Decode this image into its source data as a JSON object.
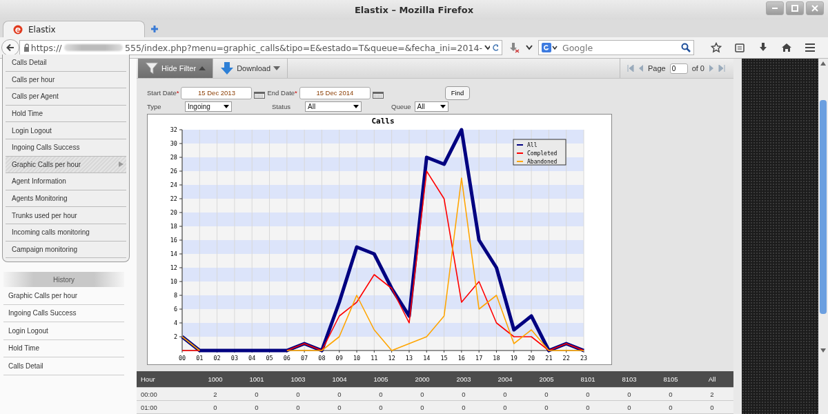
{
  "browser": {
    "title": "Elastix – Mozilla Firefox",
    "tab": "Elastix",
    "url_scheme": "https://",
    "url": "555/index.php?menu=graphic_calls&tipo=E&estado=T&queue=&fecha_ini=2014-",
    "search_placeholder": "Google"
  },
  "sidebar": {
    "items": [
      {
        "label": "Calls Detail",
        "selected": false
      },
      {
        "label": "Calls per hour",
        "selected": false
      },
      {
        "label": "Calls per Agent",
        "selected": false
      },
      {
        "label": "Hold Time",
        "selected": false
      },
      {
        "label": "Login Logout",
        "selected": false
      },
      {
        "label": "Ingoing Calls Success",
        "selected": false
      },
      {
        "label": "Graphic Calls per hour",
        "selected": true
      },
      {
        "label": "Agent Information",
        "selected": false
      },
      {
        "label": "Agents Monitoring",
        "selected": false
      },
      {
        "label": "Trunks used per hour",
        "selected": false
      },
      {
        "label": "Incoming calls monitoring",
        "selected": false
      },
      {
        "label": "Campaign monitoring",
        "selected": false
      }
    ],
    "history_title": "History",
    "history": [
      "Graphic Calls per hour",
      "Ingoing Calls Success",
      "Login Logout",
      "Hold Time",
      "Calls Detail"
    ]
  },
  "toolbar": {
    "hide_filter": "Hide Filter",
    "download": "Download",
    "page_label": "Page",
    "page_value": "0",
    "of_label": "of 0"
  },
  "filter": {
    "start_label": "Start Date",
    "start_value": "15 Dec 2013",
    "end_label": "End Date",
    "end_value": "15 Dec 2014",
    "required_mark": "*",
    "find": "Find",
    "type_label": "Type",
    "type_value": "Ingoing",
    "status_label": "Status",
    "status_value": "All",
    "queue_label": "Queue",
    "queue_value": "All"
  },
  "chart": {
    "chart_data": {
      "type": "line",
      "title": "Calls",
      "categories": [
        "00",
        "01",
        "02",
        "03",
        "04",
        "05",
        "06",
        "07",
        "08",
        "09",
        "10",
        "11",
        "12",
        "13",
        "14",
        "15",
        "16",
        "17",
        "18",
        "19",
        "20",
        "21",
        "22",
        "23"
      ],
      "ylim": [
        0,
        32
      ],
      "grid": true,
      "legend": true,
      "yticks": [
        2,
        4,
        6,
        8,
        10,
        12,
        14,
        16,
        18,
        20,
        22,
        24,
        26,
        28,
        30,
        32
      ],
      "series": [
        {
          "name": "All",
          "color": "#000080",
          "values": [
            2,
            0,
            0,
            0,
            0,
            0,
            0,
            1,
            0,
            7,
            15,
            14,
            9,
            5,
            28,
            27,
            32,
            16,
            12,
            3,
            5,
            0,
            1,
            0
          ]
        },
        {
          "name": "Completed",
          "color": "#ff0000",
          "values": [
            0,
            0,
            null,
            null,
            null,
            null,
            0,
            1,
            0,
            5,
            7,
            11,
            9,
            4,
            26,
            22,
            7,
            10,
            4,
            2,
            2,
            0,
            1,
            0
          ]
        },
        {
          "name": "Abandoned",
          "color": "#ffa500",
          "values": [
            2,
            0,
            null,
            null,
            null,
            null,
            0,
            0,
            0,
            2,
            8,
            3,
            0,
            1,
            2,
            5,
            25,
            6,
            8,
            1,
            3,
            0,
            0,
            0
          ]
        }
      ]
    }
  },
  "table": {
    "columns": [
      "Hour",
      "1000",
      "1001",
      "1003",
      "1004",
      "1005",
      "2000",
      "2003",
      "2004",
      "2005",
      "8101",
      "8103",
      "8105",
      "All"
    ],
    "rows": [
      [
        "00:00",
        "2",
        "0",
        "0",
        "0",
        "0",
        "0",
        "0",
        "0",
        "0",
        "0",
        "0",
        "0",
        "2"
      ],
      [
        "01:00",
        "0",
        "0",
        "0",
        "0",
        "0",
        "0",
        "0",
        "0",
        "0",
        "0",
        "0",
        "0",
        "0"
      ]
    ]
  }
}
